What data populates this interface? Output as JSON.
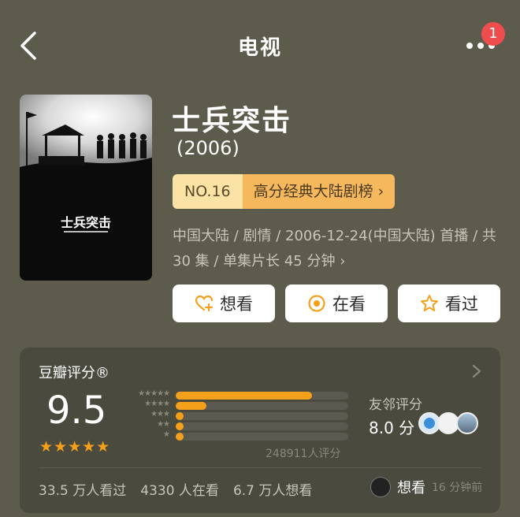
{
  "nav": {
    "title": "电视",
    "badge": "1"
  },
  "poster": {
    "overlay_title": "士兵突击"
  },
  "show": {
    "title": "士兵突击",
    "year": "(2006)",
    "rank_no": "NO.16",
    "rank_list": "高分经典大陆剧榜 ›",
    "meta_line1": "中国大陆 / 剧情 / 2006-12-24(中国大陆) 首播 / 共",
    "meta_line2": "30 集 / 单集片长 45 分钟 ›"
  },
  "actions": [
    {
      "label": "想看",
      "icon": "heart-plus-icon"
    },
    {
      "label": "在看",
      "icon": "target-icon"
    },
    {
      "label": "看过",
      "icon": "star-icon"
    }
  ],
  "rating": {
    "title": "豆瓣评分®",
    "score": "9.5",
    "stars": "★★★★★",
    "distribution": [
      {
        "stars": "★★★★★",
        "fraction": 0.79
      },
      {
        "stars": "★★★★",
        "fraction": 0.18
      },
      {
        "stars": "★★★",
        "fraction": 0.03
      },
      {
        "stars": "★★",
        "fraction": 0.02
      },
      {
        "stars": "★",
        "fraction": 0.02
      }
    ],
    "count": "248911人评分",
    "friend_label": "友邻评分",
    "friend_score": "8.0 分",
    "stats": [
      "33.5 万人看过",
      "4330 人在看",
      "6.7 万人想看"
    ],
    "recent_action": "想看",
    "recent_time": "16 分钟前"
  },
  "colors": {
    "accent": "#f4a01a",
    "background": "#5d5b4c",
    "card": "#4a4a3f",
    "badge": "#ef4d4d"
  }
}
